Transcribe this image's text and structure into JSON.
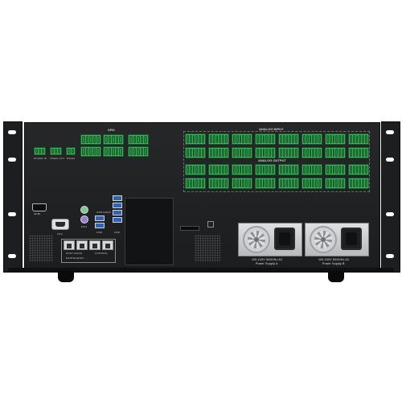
{
  "device": {
    "top_labels": {
      "gpio": "GPIO",
      "analog_input": "ANALOG INPUT",
      "analog_output": "ANALOG OUTPUT",
      "usb_audio": "USB AUDIO"
    },
    "terminal_labels": {
      "sound_in": "SOUND IN",
      "video_out": "VIDEO OUT",
      "rs232": "RS232"
    },
    "port_labels": {
      "hdmi": "HDMI",
      "vga": "VGA",
      "ps2": "PS/2",
      "usb": "USB",
      "usb2": "USB",
      "host_audio": "HOST AUDIO",
      "control": "CONTROL",
      "dante_note": "DANTE/AES67 ..."
    },
    "power_supplies": [
      {
        "rating": "100-240V 50/60Hz AC",
        "name": "Power Supply A"
      },
      {
        "rating": "100-240V 50/60Hz AC",
        "name": "Power Supply B"
      }
    ],
    "colors": {
      "terminal_green": "#3bb15a",
      "usb_blue": "#2f63b8",
      "chassis": "#161718"
    }
  }
}
